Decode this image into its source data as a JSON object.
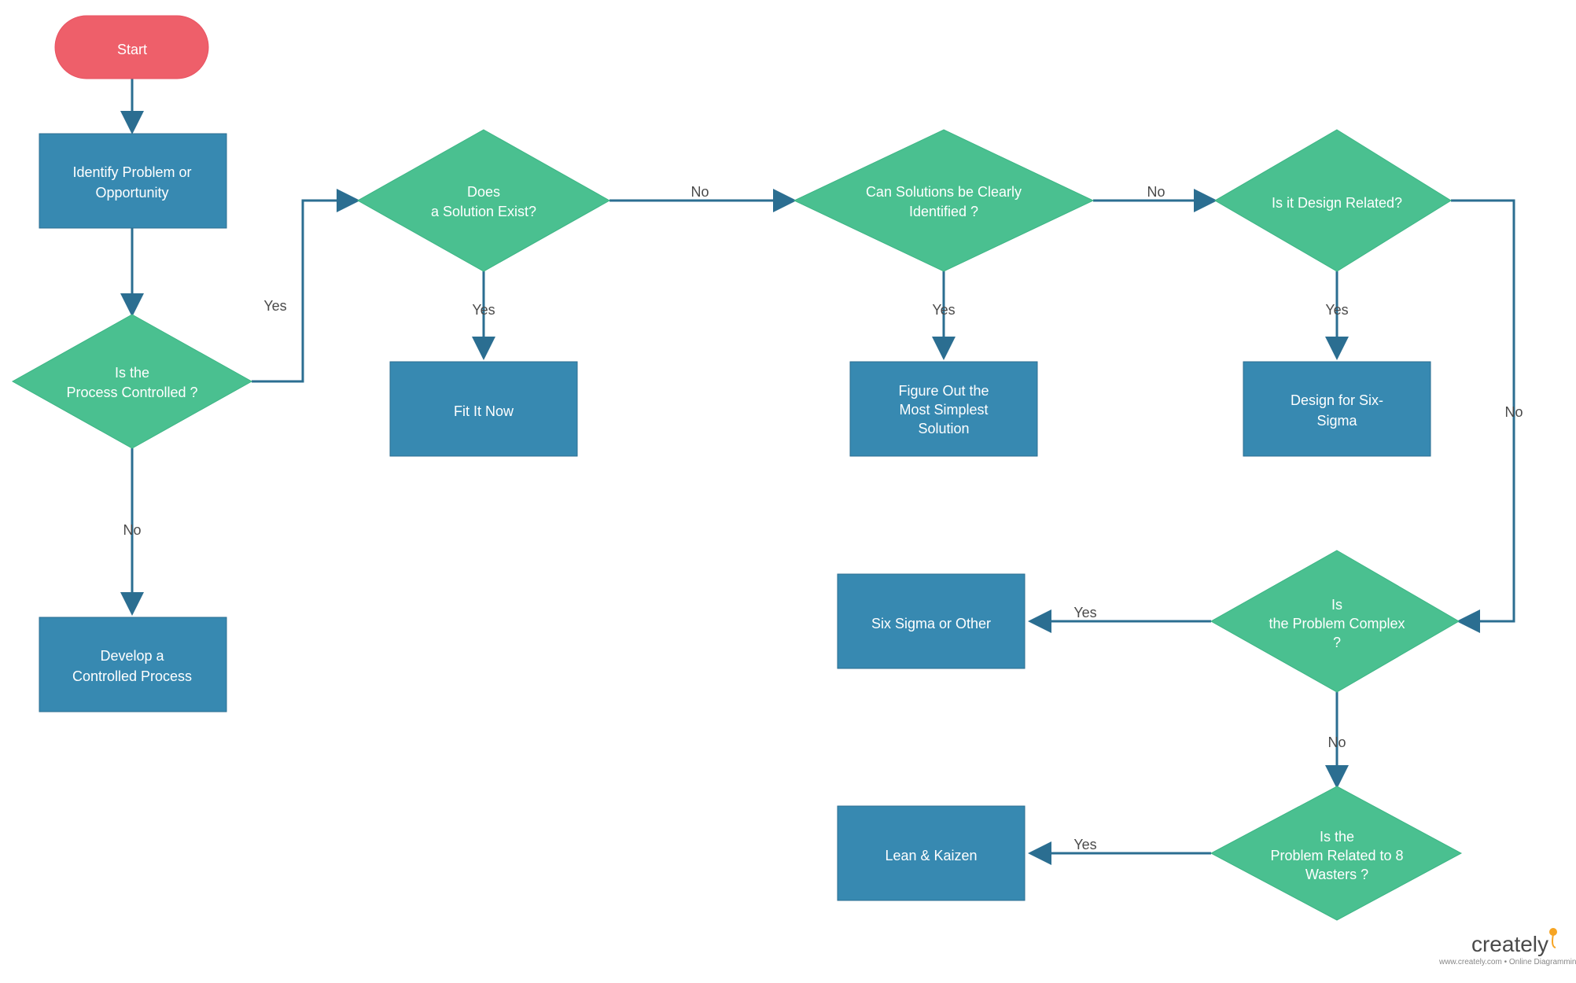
{
  "nodes": {
    "start": "Start",
    "identify_l1": "Identify Problem or",
    "identify_l2": "Opportunity",
    "controlled_l1": "Is the",
    "controlled_l2": "Process Controlled  ?",
    "develop_l1": "Develop a",
    "develop_l2": "Controlled Process",
    "solexist_l1": "Does",
    "solexist_l2": "a Solution  Exist?",
    "fitit": "Fit It Now",
    "canident_l1": "Can Solutions be Clearly",
    "canident_l2": "Identified ?",
    "figure_l1": "Figure Out the",
    "figure_l2": "Most Simplest",
    "figure_l3": "Solution",
    "design_l1": "Is it Design Related?",
    "dfss_l1": "Design for Six-",
    "dfss_l2": "Sigma",
    "complex_l1": "Is",
    "complex_l2": "the Problem  Complex",
    "complex_l3": "?",
    "sixsigma": "Six Sigma or Other",
    "wasters_l1": "Is the",
    "wasters_l2": "Problem Related  to 8",
    "wasters_l3": "Wasters ?",
    "lean": "Lean & Kaizen"
  },
  "labels": {
    "yes": "Yes",
    "no": "No"
  },
  "brand": {
    "name": "creately",
    "sub": "www.creately.com • Online Diagramming"
  }
}
